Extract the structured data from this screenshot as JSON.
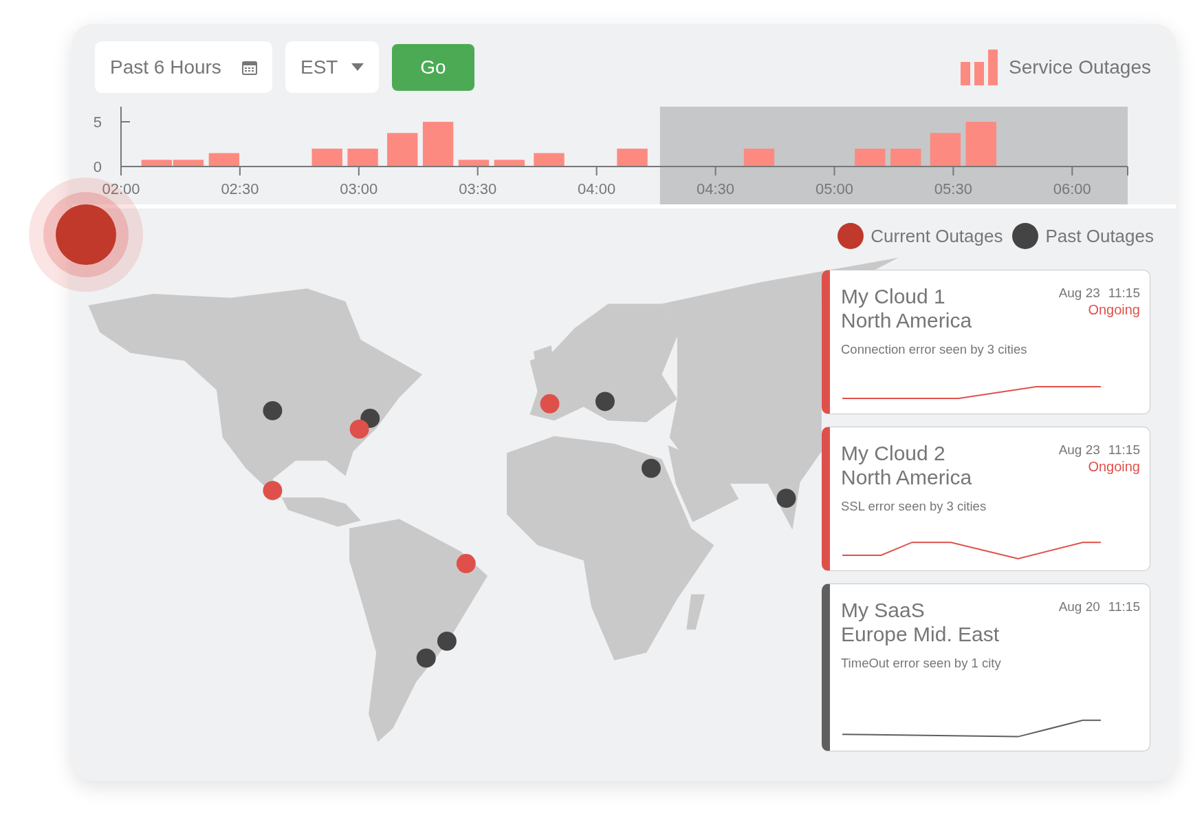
{
  "filters": {
    "time_range": "Past 6 Hours",
    "timezone": "EST",
    "go_button": "Go"
  },
  "chart": {
    "chart_data": {
      "type": "bar",
      "x": [
        129,
        137,
        146,
        172,
        181,
        191,
        200,
        209,
        218,
        228,
        249,
        281,
        309,
        318,
        328,
        337
      ],
      "series": [
        {
          "name": "Service Outages",
          "color": "#fd8a80",
          "values": [
            0.75,
            0.75,
            1.5,
            2,
            2,
            3.75,
            5,
            0.75,
            0.75,
            1.5,
            2,
            2,
            2,
            2,
            3.75,
            5
          ]
        }
      ],
      "xlim": [
        120,
        374
      ],
      "ylim": [
        0,
        6.7
      ],
      "xticks": [
        {
          "value": 120,
          "label": "02:00"
        },
        {
          "value": 150,
          "label": "02:30"
        },
        {
          "value": 180,
          "label": "03:00"
        },
        {
          "value": 210,
          "label": "03:30"
        },
        {
          "value": 240,
          "label": "04:00"
        },
        {
          "value": 270,
          "label": "04:30"
        },
        {
          "value": 300,
          "label": "05:00"
        },
        {
          "value": 330,
          "label": "05:30"
        },
        {
          "value": 360,
          "label": "06:00"
        }
      ],
      "yticks": [
        0,
        5
      ],
      "bands": [
        {
          "axis": "x",
          "from": 256,
          "to": 374
        }
      ]
    }
  },
  "legend": [
    {
      "label": "Current Outages",
      "color": "#c0392b"
    },
    {
      "label": "Past Outages",
      "color": "#444444"
    }
  ],
  "map": {
    "pins": [
      {
        "color": "#444444"
      },
      {
        "color": "#444444"
      },
      {
        "color": "#e0504a"
      },
      {
        "color": "#e0504a"
      },
      {
        "color": "#e0504a"
      },
      {
        "color": "#444444"
      },
      {
        "color": "#444444"
      },
      {
        "color": "#444444"
      },
      {
        "color": "#e0504a"
      },
      {
        "color": "#444444"
      },
      {
        "color": "#444444"
      }
    ]
  },
  "outages": [
    {
      "service": "My Cloud 1",
      "region": "North America",
      "date": "Aug 23",
      "time": "11:15",
      "status": "Ongoing",
      "color": "#e0504a",
      "description": "Connection error seen by 3 cities"
    },
    {
      "service": "My Cloud 2",
      "region": "North America",
      "date": "Aug 23",
      "time": "11:15",
      "status": "Ongoing",
      "color": "#e0504a",
      "description": "SSL error seen by 3 cities"
    },
    {
      "service": "My SaaS",
      "region": "Europe Mid. East",
      "date": "Aug 20",
      "time": "11:15",
      "color": "#5f5f5f",
      "description": "TimeOut error seen by 1 city"
    }
  ]
}
